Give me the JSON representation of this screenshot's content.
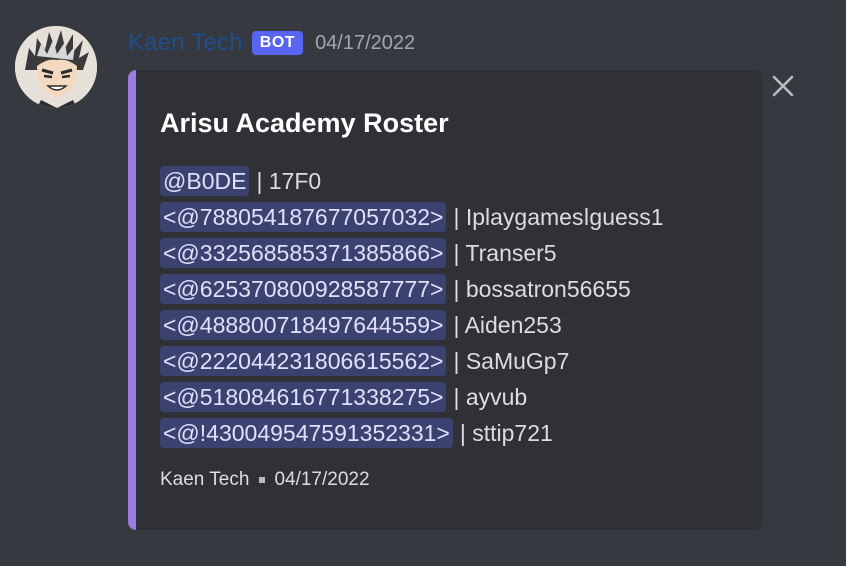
{
  "message": {
    "author": "Kaen Tech",
    "bot_tag": "BOT",
    "timestamp": "04/17/2022"
  },
  "embed": {
    "title": "Arisu Academy Roster",
    "accent_color": "#9b7be0",
    "lines": [
      {
        "mention": "@B0DE",
        "rest": "| 17F0"
      },
      {
        "mention": "<@788054187677057032>",
        "rest": "| Iplaygamesǀguess1"
      },
      {
        "mention": "<@332568585371385866>",
        "rest": "| Transer5"
      },
      {
        "mention": "<@625370800928587777>",
        "rest": "| bossatron56655"
      },
      {
        "mention": "<@488800718497644559>",
        "rest": "| Aiden253"
      },
      {
        "mention": "<@222044231806615562>",
        "rest": "| SaMuGp7"
      },
      {
        "mention": "<@518084616771338275>",
        "rest": "| ayvub"
      },
      {
        "mention": "<@!430049547591352331>",
        "rest": "| sttip721"
      }
    ],
    "footer": {
      "author": "Kaen Tech",
      "timestamp": "04/17/2022"
    }
  },
  "icons": {
    "close": "close-icon",
    "avatar": "avatar-image"
  },
  "colors": {
    "background": "#36393f",
    "embed_background": "#2f3136",
    "bot_tag": "#5865f2",
    "mention_background": "#3c4270",
    "author_name": "#1f4e8f"
  }
}
